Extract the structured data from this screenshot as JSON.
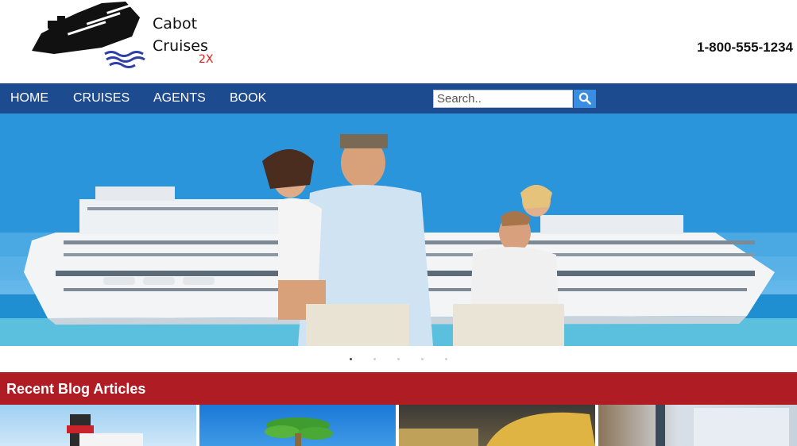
{
  "brand": {
    "name": "Cabot\nCruises",
    "tag": "2X"
  },
  "contact": {
    "phone": "1-800-555-1234"
  },
  "nav": {
    "items": [
      {
        "label": "HOME"
      },
      {
        "label": "CRUISES"
      },
      {
        "label": "AGENTS"
      },
      {
        "label": "BOOK"
      }
    ]
  },
  "search": {
    "placeholder": "Search..",
    "value": ""
  },
  "carousel": {
    "slide_count": 5,
    "active_index": 0
  },
  "blog": {
    "heading": "Recent Blog Articles"
  },
  "colors": {
    "nav": "#1d4b8f",
    "blog_bar": "#b01c24",
    "search_button": "#3a8ee2",
    "logo_tag": "#e41b1b"
  },
  "icons": {
    "search": "search-icon",
    "logo": "cruise-ship-icon"
  }
}
